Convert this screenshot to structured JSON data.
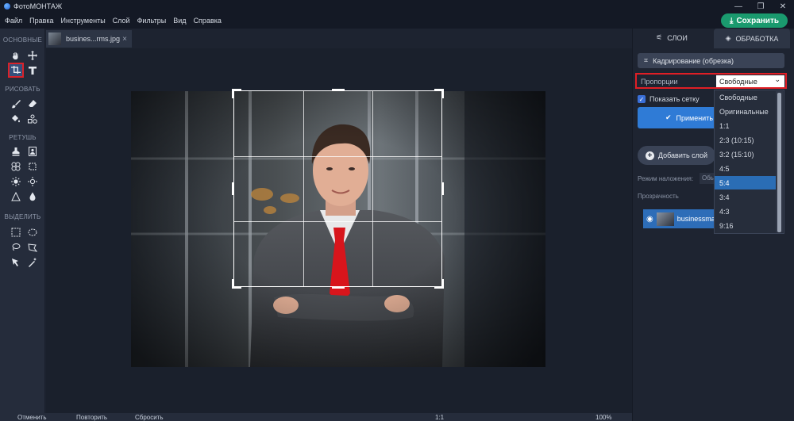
{
  "app": {
    "title": "ФотоМОНТАЖ"
  },
  "window_controls": [
    "—",
    "❐",
    "✕"
  ],
  "menu": [
    "Файл",
    "Правка",
    "Инструменты",
    "Слой",
    "Фильтры",
    "Вид",
    "Справка"
  ],
  "save_label": "Сохранить",
  "toolbar": {
    "sections": [
      "ОСНОВНЫЕ",
      "РИСОВАТЬ",
      "РЕТУШЬ",
      "ВЫДЕЛИТЬ"
    ],
    "active_tool": "crop-tool"
  },
  "document_tab": {
    "label": "busines...rms.jpg",
    "close": "×"
  },
  "right_panel": {
    "tabs": [
      "СЛОИ",
      "ОБРАБОТКА"
    ],
    "crop_title": "Кадрирование (обрезка)",
    "proportions_label": "Пропорции",
    "proportions_value": "Свободные",
    "show_grid_label": "Показать сетку",
    "show_grid_checked": true,
    "apply_label": "Применить",
    "add_layer_label": "Добавить слой",
    "blend_label": "Режим наложения:",
    "blend_value": "Обы",
    "opacity_label": "Прозрачность",
    "layer_name": "businessma"
  },
  "dropdown": {
    "options": [
      "Свободные",
      "Оригинальные",
      "1:1",
      "2:3 (10:15)",
      "3:2 (15:10)",
      "4:5",
      "5:4",
      "3:4",
      "4:3",
      "9:16"
    ],
    "selected_index": 6
  },
  "bottom_bar": {
    "left1": "Отменить",
    "left2": "Повторить",
    "left3": "Сбросить",
    "ratio": "1:1",
    "zoom": "100%"
  },
  "colors": {
    "accent": "#2f7bd6",
    "save": "#1a9a6e",
    "highlight": "#e01e25",
    "background": "#1d2330"
  }
}
